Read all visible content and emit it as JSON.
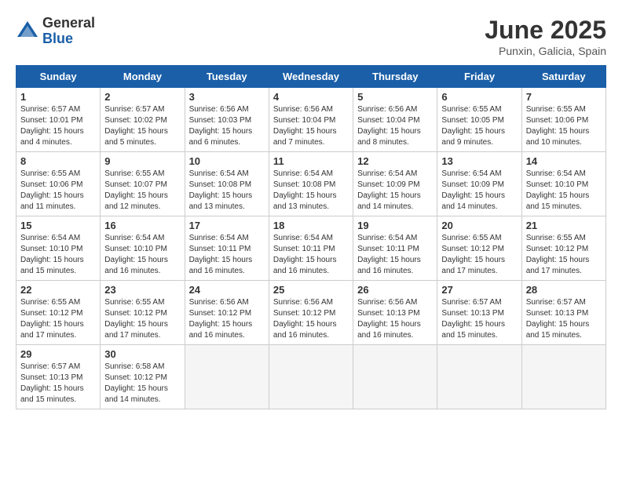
{
  "logo": {
    "general": "General",
    "blue": "Blue"
  },
  "title": "June 2025",
  "subtitle": "Punxin, Galicia, Spain",
  "days_header": [
    "Sunday",
    "Monday",
    "Tuesday",
    "Wednesday",
    "Thursday",
    "Friday",
    "Saturday"
  ],
  "weeks": [
    [
      {
        "num": "1",
        "rise": "6:57 AM",
        "set": "10:01 PM",
        "daylight": "15 hours and 4 minutes."
      },
      {
        "num": "2",
        "rise": "6:57 AM",
        "set": "10:02 PM",
        "daylight": "15 hours and 5 minutes."
      },
      {
        "num": "3",
        "rise": "6:56 AM",
        "set": "10:03 PM",
        "daylight": "15 hours and 6 minutes."
      },
      {
        "num": "4",
        "rise": "6:56 AM",
        "set": "10:04 PM",
        "daylight": "15 hours and 7 minutes."
      },
      {
        "num": "5",
        "rise": "6:56 AM",
        "set": "10:04 PM",
        "daylight": "15 hours and 8 minutes."
      },
      {
        "num": "6",
        "rise": "6:55 AM",
        "set": "10:05 PM",
        "daylight": "15 hours and 9 minutes."
      },
      {
        "num": "7",
        "rise": "6:55 AM",
        "set": "10:06 PM",
        "daylight": "15 hours and 10 minutes."
      }
    ],
    [
      {
        "num": "8",
        "rise": "6:55 AM",
        "set": "10:06 PM",
        "daylight": "15 hours and 11 minutes."
      },
      {
        "num": "9",
        "rise": "6:55 AM",
        "set": "10:07 PM",
        "daylight": "15 hours and 12 minutes."
      },
      {
        "num": "10",
        "rise": "6:54 AM",
        "set": "10:08 PM",
        "daylight": "15 hours and 13 minutes."
      },
      {
        "num": "11",
        "rise": "6:54 AM",
        "set": "10:08 PM",
        "daylight": "15 hours and 13 minutes."
      },
      {
        "num": "12",
        "rise": "6:54 AM",
        "set": "10:09 PM",
        "daylight": "15 hours and 14 minutes."
      },
      {
        "num": "13",
        "rise": "6:54 AM",
        "set": "10:09 PM",
        "daylight": "15 hours and 14 minutes."
      },
      {
        "num": "14",
        "rise": "6:54 AM",
        "set": "10:10 PM",
        "daylight": "15 hours and 15 minutes."
      }
    ],
    [
      {
        "num": "15",
        "rise": "6:54 AM",
        "set": "10:10 PM",
        "daylight": "15 hours and 15 minutes."
      },
      {
        "num": "16",
        "rise": "6:54 AM",
        "set": "10:10 PM",
        "daylight": "15 hours and 16 minutes."
      },
      {
        "num": "17",
        "rise": "6:54 AM",
        "set": "10:11 PM",
        "daylight": "15 hours and 16 minutes."
      },
      {
        "num": "18",
        "rise": "6:54 AM",
        "set": "10:11 PM",
        "daylight": "15 hours and 16 minutes."
      },
      {
        "num": "19",
        "rise": "6:54 AM",
        "set": "10:11 PM",
        "daylight": "15 hours and 16 minutes."
      },
      {
        "num": "20",
        "rise": "6:55 AM",
        "set": "10:12 PM",
        "daylight": "15 hours and 17 minutes."
      },
      {
        "num": "21",
        "rise": "6:55 AM",
        "set": "10:12 PM",
        "daylight": "15 hours and 17 minutes."
      }
    ],
    [
      {
        "num": "22",
        "rise": "6:55 AM",
        "set": "10:12 PM",
        "daylight": "15 hours and 17 minutes."
      },
      {
        "num": "23",
        "rise": "6:55 AM",
        "set": "10:12 PM",
        "daylight": "15 hours and 17 minutes."
      },
      {
        "num": "24",
        "rise": "6:56 AM",
        "set": "10:12 PM",
        "daylight": "15 hours and 16 minutes."
      },
      {
        "num": "25",
        "rise": "6:56 AM",
        "set": "10:12 PM",
        "daylight": "15 hours and 16 minutes."
      },
      {
        "num": "26",
        "rise": "6:56 AM",
        "set": "10:13 PM",
        "daylight": "15 hours and 16 minutes."
      },
      {
        "num": "27",
        "rise": "6:57 AM",
        "set": "10:13 PM",
        "daylight": "15 hours and 15 minutes."
      },
      {
        "num": "28",
        "rise": "6:57 AM",
        "set": "10:13 PM",
        "daylight": "15 hours and 15 minutes."
      }
    ],
    [
      {
        "num": "29",
        "rise": "6:57 AM",
        "set": "10:13 PM",
        "daylight": "15 hours and 15 minutes."
      },
      {
        "num": "30",
        "rise": "6:58 AM",
        "set": "10:12 PM",
        "daylight": "15 hours and 14 minutes."
      },
      null,
      null,
      null,
      null,
      null
    ]
  ]
}
